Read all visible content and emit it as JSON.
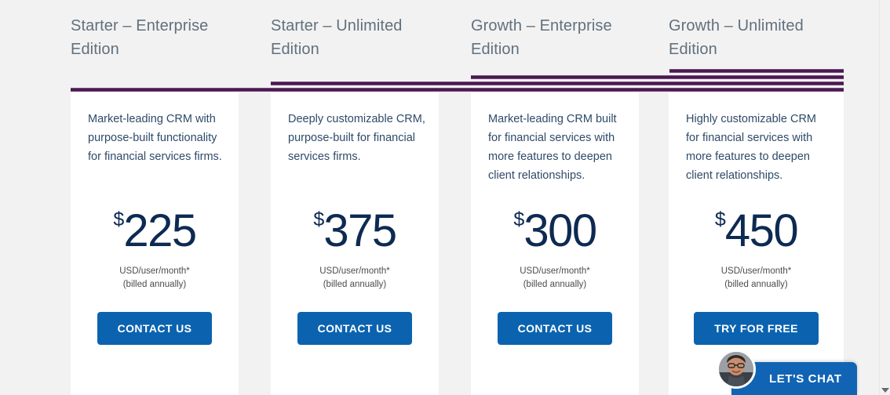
{
  "theme": {
    "page_background": "#f2f2f2",
    "card_background": "#ffffff",
    "accent_purple": "#4a1a4f",
    "accent_purple_light": "#7a4a82",
    "price_navy": "#0d2a52",
    "body_text": "#2e4a69",
    "heading_gray": "#62707d",
    "cta_blue": "#0b63b0",
    "chat_blue": "#1164b4"
  },
  "columns": [
    {
      "title": "Starter – Enterprise Edition",
      "description": "Market-leading CRM with purpose-built functionality for financial services firms.",
      "currency_symbol": "$",
      "price": "225",
      "price_unit": "USD/user/month*",
      "billing_note": "(billed annually)",
      "cta_label": "CONTACT US"
    },
    {
      "title": "Starter – Unlimited Edition",
      "description": "Deeply customizable CRM, purpose-built for financial services firms.",
      "currency_symbol": "$",
      "price": "375",
      "price_unit": "USD/user/month*",
      "billing_note": "(billed annually)",
      "cta_label": "CONTACT US"
    },
    {
      "title": "Growth – Enterprise Edition",
      "description": "Market-leading CRM built for financial services with more features to deepen client relationships.",
      "currency_symbol": "$",
      "price": "300",
      "price_unit": "USD/user/month*",
      "billing_note": "(billed annually)",
      "cta_label": "CONTACT US"
    },
    {
      "title": "Growth – Unlimited Edition",
      "description": "Highly customizable CRM for financial services with more features to deepen client relationships.",
      "currency_symbol": "$",
      "price": "450",
      "price_unit": "USD/user/month*",
      "billing_note": "(billed annually)",
      "cta_label": "TRY FOR FREE"
    }
  ],
  "chat": {
    "label": "LET'S CHAT",
    "avatar_icon": "agent-avatar-photo"
  },
  "scrollbar": {
    "down_arrow_icon": "chevron-down-icon"
  }
}
